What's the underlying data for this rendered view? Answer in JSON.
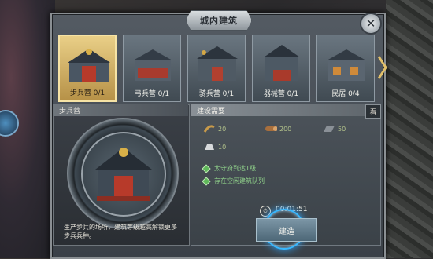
{
  "window": {
    "title": "城内建筑",
    "close_symbol": "✕"
  },
  "buildings": [
    {
      "label": "步兵营 0/1",
      "selected": true
    },
    {
      "label": "弓兵营 0/1",
      "selected": false
    },
    {
      "label": "骑兵营 0/1",
      "selected": false
    },
    {
      "label": "器械营 0/1",
      "selected": false
    },
    {
      "label": "民居 0/4",
      "selected": false
    }
  ],
  "left_panel": {
    "title": "步兵营",
    "description": "生产步兵的场所，建筑等级越高解锁更多步兵兵种。"
  },
  "right_panel": {
    "title": "建设需要",
    "tab": "看",
    "resources": [
      {
        "icon": "food-icon",
        "value": "20"
      },
      {
        "icon": "wood-icon",
        "value": "200"
      },
      {
        "icon": "iron-icon",
        "value": "50"
      },
      {
        "icon": "stone-icon",
        "value": "10"
      }
    ],
    "requirements": [
      "太守府到达1级",
      "存在空闲建筑队列"
    ],
    "time": "00:01:51",
    "build_label": "建造"
  },
  "colors": {
    "selected_card": "#e9cf87",
    "requirement_text": "#8fd08a",
    "glow": "#2fa7ff"
  }
}
